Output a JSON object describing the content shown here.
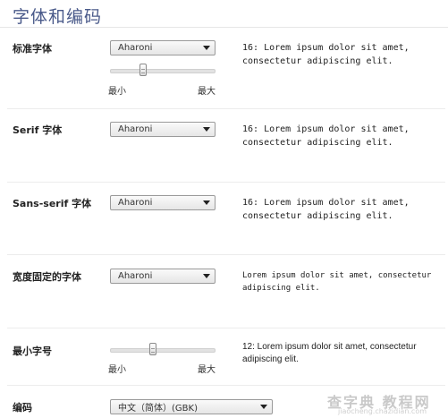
{
  "section_title": "字体和编码",
  "rows": [
    {
      "label": "标准字体",
      "font": "Aharoni",
      "sample": "16: Lorem ipsum dolor sit amet, consectetur adipiscing elit."
    },
    {
      "label": "Serif 字体",
      "font": "Aharoni",
      "sample": "16: Lorem ipsum dolor sit amet, consectetur adipiscing elit."
    },
    {
      "label": "Sans-serif 字体",
      "font": "Aharoni",
      "sample": "16: Lorem ipsum dolor sit amet, consectetur adipiscing elit."
    },
    {
      "label": "宽度固定的字体",
      "font": "Aharoni",
      "sample": "Lorem ipsum dolor sit amet, consectetur adipiscing elit."
    }
  ],
  "standard_slider": {
    "min_label": "最小",
    "max_label": "最大",
    "value_fraction": 0.3
  },
  "min_size": {
    "label": "最小字号",
    "min_label": "最小",
    "max_label": "最大",
    "value_fraction": 0.4,
    "sample": "12: Lorem ipsum dolor sit amet, consectetur adipiscing elit."
  },
  "encoding": {
    "label": "编码",
    "value": "中文（简体）(GBK)"
  },
  "watermark": {
    "line1": "查字典 教程网",
    "line2": "jiaocheng.chazidian.com"
  }
}
